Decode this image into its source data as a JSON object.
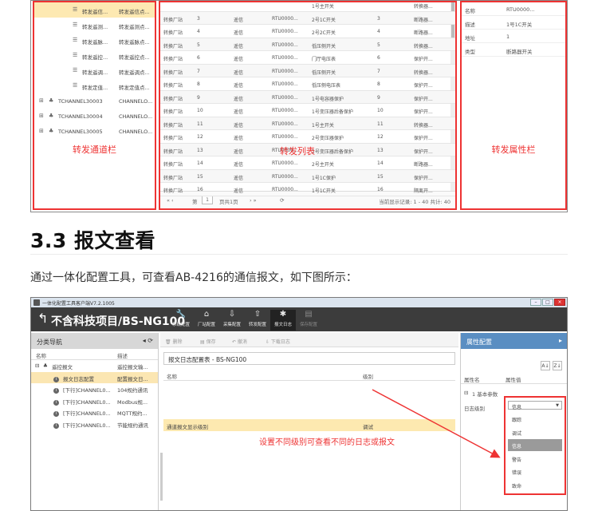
{
  "top_screenshot": {
    "tree": {
      "rows": [
        {
          "label": "转发遥信...",
          "value": "转发遥信点...",
          "indent": 2,
          "selected": true
        },
        {
          "label": "转发遥测...",
          "value": "转发遥测点...",
          "indent": 2,
          "selected": false
        },
        {
          "label": "转发遥脉...",
          "value": "转发遥脉点...",
          "indent": 2,
          "selected": false
        },
        {
          "label": "转发遥控...",
          "value": "转发遥控点...",
          "indent": 2,
          "selected": false
        },
        {
          "label": "转发遥调...",
          "value": "转发遥调点...",
          "indent": 2,
          "selected": false
        },
        {
          "label": "转发定值...",
          "value": "转发定值点...",
          "indent": 2,
          "selected": false
        },
        {
          "label": "TCHANNEL30003",
          "value": "CHANNELO...",
          "indent": 0,
          "selected": false
        },
        {
          "label": "TCHANNEL30004",
          "value": "CHANNELO...",
          "indent": 0,
          "selected": false
        },
        {
          "label": "TCHANNEL30005",
          "value": "CHANNELO...",
          "indent": 0,
          "selected": false
        }
      ],
      "caption": "转发通道栏"
    },
    "grid": {
      "rows": [
        [
          "",
          "",
          "",
          "",
          "1号主开关",
          "",
          "转换器..."
        ],
        [
          "转换厂站",
          "3",
          "遥信",
          "RTU0000...",
          "2号1C开关",
          "3",
          "断路器..."
        ],
        [
          "转换厂站",
          "4",
          "遥信",
          "RTU0000...",
          "2号2C开关",
          "4",
          "断路器..."
        ],
        [
          "转换厂站",
          "5",
          "遥信",
          "RTU0000...",
          "低压侧开关",
          "5",
          "转换器..."
        ],
        [
          "转换厂站",
          "6",
          "遥信",
          "RTU0000...",
          "门厅电压表",
          "6",
          "保护开..."
        ],
        [
          "转换厂站",
          "7",
          "遥信",
          "RTU0000...",
          "低压侧开关",
          "7",
          "转换器..."
        ],
        [
          "转换厂站",
          "8",
          "遥信",
          "RTU0000...",
          "低压侧电压表",
          "8",
          "保护开..."
        ],
        [
          "转换厂站",
          "9",
          "遥信",
          "RTU0000...",
          "1号电容器保护",
          "9",
          "保护开..."
        ],
        [
          "转换厂站",
          "10",
          "遥信",
          "RTU0000...",
          "1号变压器后备保护",
          "10",
          "保护开..."
        ],
        [
          "转换厂站",
          "11",
          "遥信",
          "RTU0000...",
          "1号主开关",
          "11",
          "转换器..."
        ],
        [
          "转换厂站",
          "12",
          "遥信",
          "RTU0000...",
          "2号变压器保护",
          "12",
          "保护开..."
        ],
        [
          "转换厂站",
          "13",
          "遥信",
          "RTU0000...",
          "2号变压器后备保护",
          "13",
          "保护开..."
        ],
        [
          "转换厂站",
          "14",
          "遥信",
          "RTU0000...",
          "2号主开关",
          "14",
          "断路器..."
        ],
        [
          "转换厂站",
          "15",
          "遥信",
          "RTU0000...",
          "1号1C保护",
          "15",
          "保护开..."
        ],
        [
          "转换厂站",
          "16",
          "遥信",
          "RTU0000...",
          "1号1C开关",
          "16",
          "隔离开..."
        ]
      ],
      "caption": "转发列表",
      "pager": {
        "nav_left": "«  ‹",
        "page_label": "第",
        "page_value": "1",
        "page_total": "页共1页",
        "nav_right": "›  »",
        "refresh": "⟳",
        "summary": "当前显示记录: 1 - 40 共计: 40"
      }
    },
    "props": {
      "rows": [
        {
          "k": "名称",
          "v": "RTU0000..."
        },
        {
          "k": "描述",
          "v": "1号1C开关"
        },
        {
          "k": "地址",
          "v": "1"
        },
        {
          "k": "类型",
          "v": "断路器开关"
        }
      ],
      "caption": "转发属性栏"
    }
  },
  "section": {
    "heading": "3.3 报文查看",
    "paragraph": "通过一体化配置工具，可查看AB-4216的通信报文，如下图所示："
  },
  "app": {
    "window_title": "一体化配置工具客户端V7.2.1005",
    "project_title": "不含科技项目/BS-NG100",
    "toolbar": [
      {
        "icon": "🔧",
        "label": "系统配置",
        "name": "system-config"
      },
      {
        "icon": "⌂",
        "label": "厂站配置",
        "name": "station-config"
      },
      {
        "icon": "⇩",
        "label": "采集配置",
        "name": "collect-config"
      },
      {
        "icon": "⇧",
        "label": "转发配置",
        "name": "forward-config"
      },
      {
        "icon": "✱",
        "label": "报文日志",
        "name": "message-log"
      },
      {
        "icon": "▤",
        "label": "保存配置",
        "name": "save-config"
      }
    ],
    "left": {
      "title": "分类导航",
      "head_icons": "◂ ⟳",
      "col_name": "名称",
      "col_desc": "描述",
      "rows": [
        {
          "name": "遥控报文",
          "desc": "遥控报文输...",
          "level": 0,
          "selected": false
        },
        {
          "name": "报文日志配置",
          "desc": "配置报文日...",
          "level": 1,
          "selected": true
        },
        {
          "name": "[下行]CHANNEL0...",
          "desc": "104规约通讯",
          "level": 1,
          "selected": false
        },
        {
          "name": "[下行]CHANNEL0...",
          "desc": "Modbus规...",
          "level": 1,
          "selected": false
        },
        {
          "name": "[下行]CHANNEL0...",
          "desc": "MQTT规约...",
          "level": 1,
          "selected": false
        },
        {
          "name": "[下行]CHANNEL0...",
          "desc": "节能规约通讯",
          "level": 1,
          "selected": false
        }
      ]
    },
    "center": {
      "toolbar": [
        "🗑 删除",
        "▤ 保存",
        "↶ 撤消",
        "⇩ 下载日志"
      ],
      "table_title": "报文日志配置表 - BS-NG100",
      "col_name": "名称",
      "col_level": "级别",
      "row_name": "通道报文显示级别",
      "row_level": "调试",
      "annotation": "设置不同级别可查看不同的日志或报文"
    },
    "right": {
      "title": "属性配置",
      "head_icon": "▸",
      "sort_icons": [
        "A↓",
        "Z↓"
      ],
      "col_name": "属性名",
      "col_value": "属性值",
      "group": "1 基本参数",
      "field_name": "日志级别",
      "dropdown": {
        "current": "信息",
        "options": [
          "跟踪",
          "调试",
          "信息",
          "警告",
          "错误",
          "致命"
        ],
        "selected_index": 2
      }
    }
  },
  "colors": {
    "accent_red": "#ee3333",
    "highlight": "#fde9b0",
    "toolbar_dark": "#3c3c3c",
    "panel_blue": "#5a8ec2"
  }
}
